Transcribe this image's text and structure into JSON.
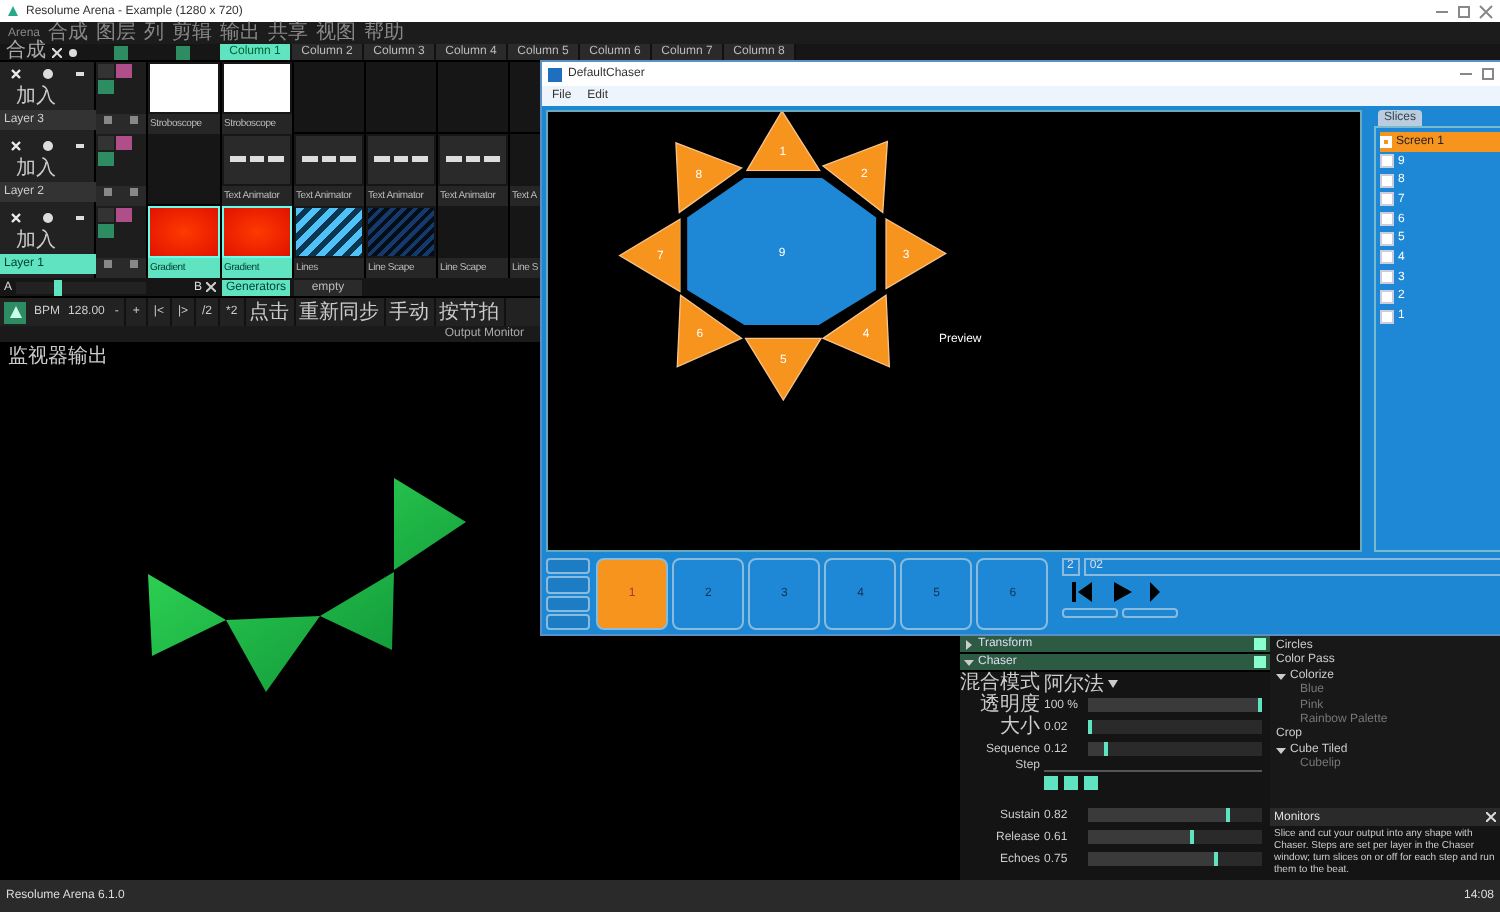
{
  "window": {
    "title": "Resolume Arena - Example (1280 x 720)"
  },
  "menu": [
    "Arena",
    "合成",
    "图层",
    "列",
    "剪辑",
    "输出",
    "共享",
    "视图",
    "帮助"
  ],
  "composition": {
    "label": "合成"
  },
  "columns": [
    {
      "label": "Column 1",
      "selected": true
    },
    {
      "label": "Column 2",
      "selected": false
    },
    {
      "label": "Column 3",
      "selected": false
    },
    {
      "label": "Column 4",
      "selected": false
    },
    {
      "label": "Column 5",
      "selected": false
    },
    {
      "label": "Column 6",
      "selected": false
    },
    {
      "label": "Column 7",
      "selected": false
    },
    {
      "label": "Column 8",
      "selected": false
    }
  ],
  "layers": [
    {
      "name": "Layer 3",
      "selected": false,
      "blend": "加入",
      "thumb": {
        "label": "Stroboscope",
        "kind": "white",
        "active": false
      },
      "clips": [
        {
          "label": "Stroboscope",
          "kind": "white",
          "active": false
        },
        {
          "kind": "none"
        },
        {
          "kind": "none"
        },
        {
          "kind": "none"
        },
        {
          "kind": "none"
        }
      ]
    },
    {
      "name": "Layer 2",
      "selected": false,
      "blend": "加入",
      "thumb": {
        "kind": "none"
      },
      "clips": [
        {
          "label": "Text Animator",
          "kind": "text",
          "active": false
        },
        {
          "label": "Text Animator",
          "kind": "text",
          "active": false
        },
        {
          "label": "Text Animator",
          "kind": "text",
          "active": false
        },
        {
          "label": "Text Animator",
          "kind": "text",
          "active": false
        },
        {
          "label": "Text A",
          "kind": "none",
          "active": false
        }
      ]
    },
    {
      "name": "Layer 1",
      "selected": true,
      "blend": "加入",
      "thumb": {
        "label": "Gradient",
        "kind": "gradient",
        "active": true
      },
      "clips": [
        {
          "label": "Gradient",
          "kind": "gradient",
          "active": true
        },
        {
          "label": "Lines",
          "kind": "lines",
          "active": false
        },
        {
          "label": "Line Scape",
          "kind": "scape",
          "active": false
        },
        {
          "label": "Line Scape",
          "kind": "none",
          "active": false
        },
        {
          "label": "Line S",
          "kind": "none",
          "active": false
        }
      ]
    }
  ],
  "crossfader": {
    "a": "A",
    "b": "B",
    "level": 0.33
  },
  "deck_tabs": [
    {
      "label": "Generators",
      "selected": true
    },
    {
      "label": "empty",
      "selected": false
    }
  ],
  "transport": {
    "bpm_label": "BPM",
    "bpm": "128.00",
    "buttons": [
      "-",
      "+",
      "|<",
      "|>",
      "/2",
      "*2",
      "点击",
      "重新同步",
      "手动",
      "按节拍"
    ]
  },
  "output_monitor": "Output Monitor",
  "preview": {
    "label": "监视器输出"
  },
  "chaser": {
    "title": "DefaultChaser",
    "menu": [
      "File",
      "Edit"
    ],
    "preview_label": "Preview",
    "center_label": "9",
    "slice_labels": [
      "1",
      "2",
      "3",
      "4",
      "5",
      "6",
      "7",
      "8"
    ],
    "tab": "Slices",
    "screen": {
      "label": "Screen 1",
      "selected": true
    },
    "slices": [
      {
        "label": "9",
        "checked": false
      },
      {
        "label": "8",
        "checked": false
      },
      {
        "label": "7",
        "checked": false
      },
      {
        "label": "6",
        "checked": false
      },
      {
        "label": "5",
        "checked": false
      },
      {
        "label": "4",
        "checked": false
      },
      {
        "label": "3",
        "checked": false
      },
      {
        "label": "2",
        "checked": false
      },
      {
        "label": "1",
        "checked": false
      }
    ],
    "steps": [
      {
        "label": "1",
        "selected": true
      },
      {
        "label": "2",
        "selected": false
      },
      {
        "label": "3",
        "selected": false
      },
      {
        "label": "4",
        "selected": false
      },
      {
        "label": "5",
        "selected": false
      },
      {
        "label": "6",
        "selected": false
      }
    ],
    "step_count": "2",
    "step_name": "02"
  },
  "effects_stack": [
    {
      "name": "Transform",
      "expanded": false
    },
    {
      "name": "Chaser",
      "expanded": true
    }
  ],
  "params": [
    {
      "kind": "dropdown",
      "label": "混合模式",
      "value": "阿尔法"
    },
    {
      "kind": "slider",
      "label": "透明度",
      "value": "100 %",
      "level": 1
    },
    {
      "kind": "slider",
      "label": "大小",
      "value": "0.02",
      "level": 0.02
    },
    {
      "kind": "slider",
      "label": "Sequence",
      "value": "0.12",
      "level": 0.12
    },
    {
      "kind": "step",
      "label": "Step"
    },
    {
      "kind": "slider",
      "label": "Sustain",
      "value": "0.82",
      "level": 0.82
    },
    {
      "kind": "slider",
      "label": "Release",
      "value": "0.61",
      "level": 0.61
    },
    {
      "kind": "slider",
      "label": "Echoes",
      "value": "0.75",
      "level": 0.75
    }
  ],
  "effects_browser": [
    {
      "label": "Circles"
    },
    {
      "label": "Color Pass"
    },
    {
      "label": "Colorize",
      "expanded": true,
      "children": [
        {
          "label": "Blue"
        },
        {
          "label": "Pink"
        },
        {
          "label": "Rainbow Palette"
        }
      ]
    },
    {
      "label": "Crop"
    },
    {
      "label": "Cube Tiled",
      "expanded": true,
      "children": [
        {
          "label": "Cubelip"
        }
      ]
    }
  ],
  "monitors": {
    "title": "Monitors",
    "text": "Slice and cut your output into any shape with Chaser. Steps are set per layer in the Chaser window; turn slices on or off for each step and run them to the beat."
  },
  "status_bar": {
    "app": "Resolume Arena 6.1.0",
    "time": "14:08"
  }
}
